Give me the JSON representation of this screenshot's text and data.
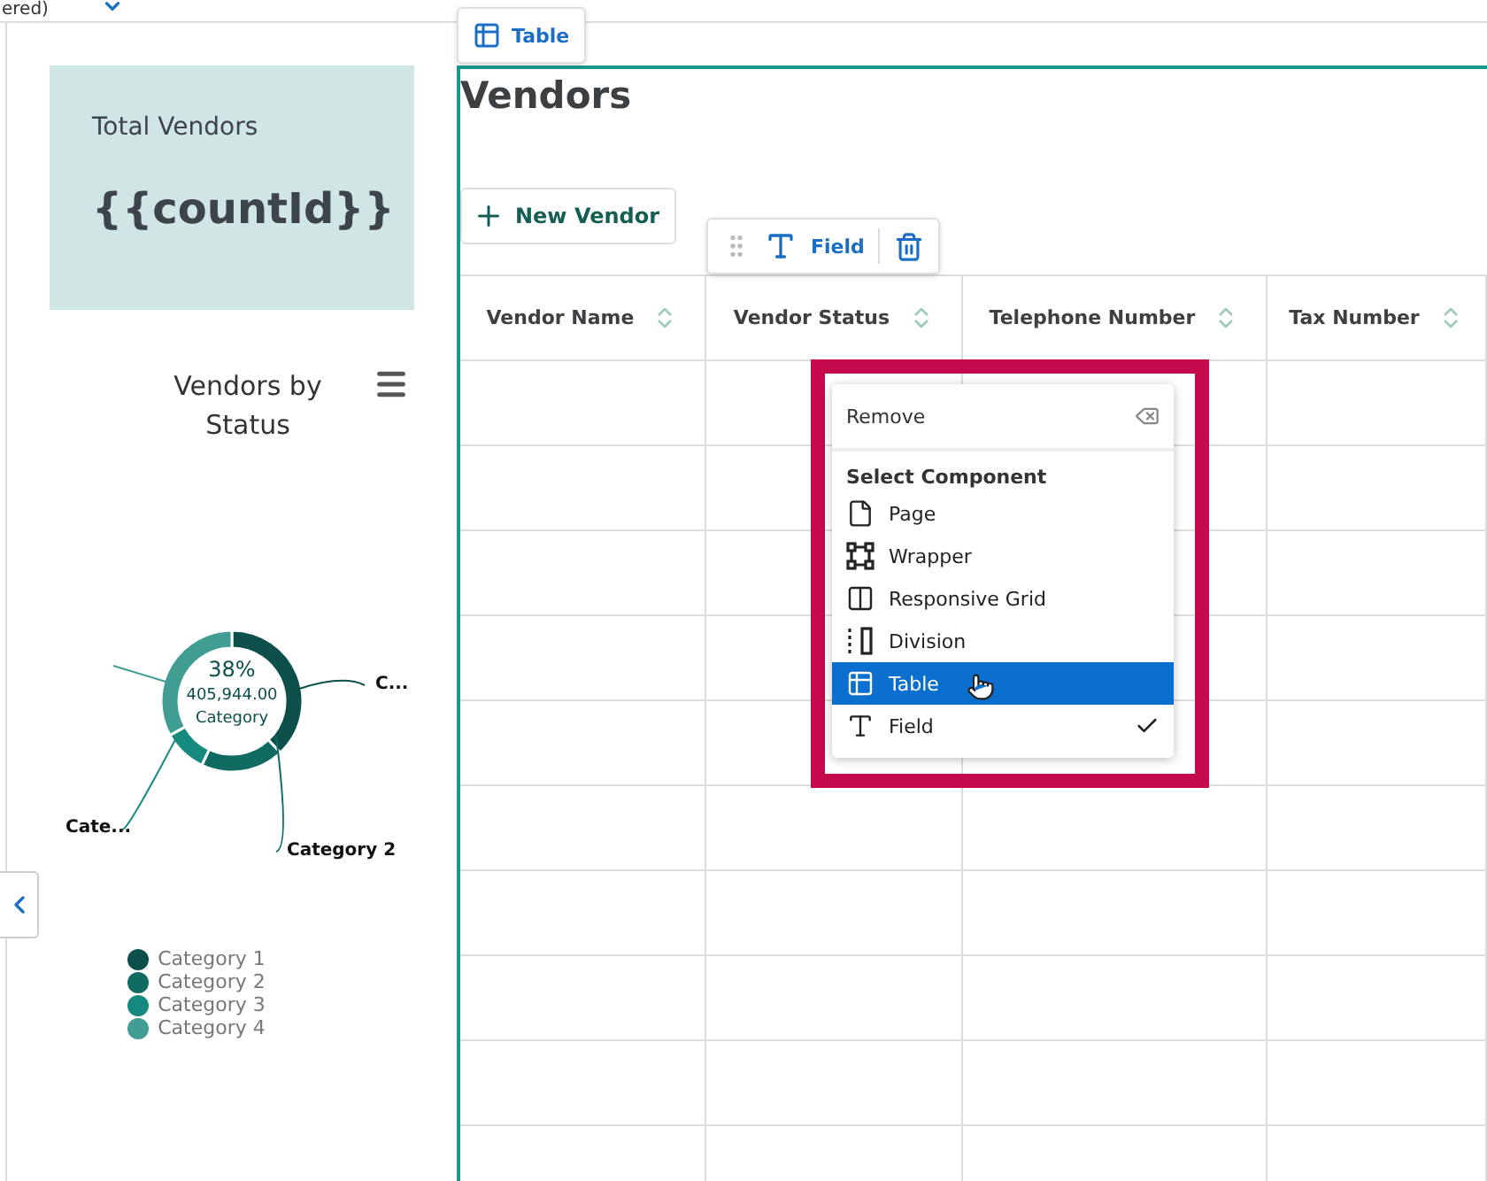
{
  "top_bar": {
    "label": "ered)"
  },
  "sidebar": {
    "stat_card": {
      "title": "Total Vendors",
      "value": "{{countId}}"
    },
    "chart_card": {
      "title": "Vendors by Status",
      "center_percent": "38%",
      "center_value": "405,944.00",
      "center_category": "Category",
      "slices": [
        {
          "color": "#0d4f4a",
          "label": "C..."
        },
        {
          "color": "#0f6b62",
          "label": "Category 2"
        },
        {
          "color": "#168a7f",
          "label": "Cate..."
        },
        {
          "color": "#3f9d94"
        }
      ],
      "legend": [
        {
          "label": "Category 1",
          "color": "#0d4f4a"
        },
        {
          "label": "Category 2",
          "color": "#0f6b62"
        },
        {
          "label": "Category 3",
          "color": "#168a7f"
        },
        {
          "label": "Category 4",
          "color": "#3f9d94"
        }
      ]
    }
  },
  "main": {
    "component_tag": "Table",
    "title": "Vendors",
    "new_button": "New Vendor",
    "field_toolbar": {
      "label": "Field"
    },
    "columns": [
      "Vendor Name",
      "Vendor Status",
      "Telephone Number",
      "Tax Number"
    ],
    "context_menu": {
      "remove": "Remove",
      "heading": "Select Component",
      "items": [
        {
          "kind": "page",
          "label": "Page",
          "selected": false,
          "checked": false
        },
        {
          "kind": "wrapper",
          "label": "Wrapper",
          "selected": false,
          "checked": false
        },
        {
          "kind": "grid",
          "label": "Responsive Grid",
          "selected": false,
          "checked": false
        },
        {
          "kind": "division",
          "label": "Division",
          "selected": false,
          "checked": false
        },
        {
          "kind": "table",
          "label": "Table",
          "selected": true,
          "checked": false
        },
        {
          "kind": "field",
          "label": "Field",
          "selected": false,
          "checked": true
        }
      ]
    }
  }
}
